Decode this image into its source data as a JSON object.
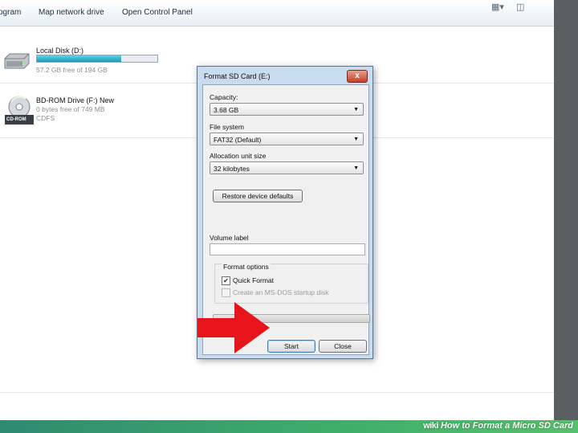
{
  "toolbar": {
    "items": [
      "ogram",
      "Map network drive",
      "Open Control Panel"
    ]
  },
  "drives": [
    {
      "name": "Local Disk (D:)",
      "free": "57.2 GB free of 194 GB",
      "used_fraction": 0.7,
      "icon": "hard-disk-icon"
    },
    {
      "name": "BD-ROM Drive (F:) New",
      "free": "0 bytes free of 749 MB",
      "fs": "CDFS",
      "icon_label": "CD-ROM",
      "icon": "optical-disc-icon"
    }
  ],
  "dialog": {
    "title": "Format SD Card (E:)",
    "close_glyph": "x",
    "capacity_label": "Capacity:",
    "capacity_value": "3.68 GB",
    "filesystem_label": "File system",
    "filesystem_value": "FAT32 (Default)",
    "allocation_label": "Allocation unit size",
    "allocation_value": "32 kilobytes",
    "restore_button": "Restore device defaults",
    "volume_label": "Volume label",
    "volume_value": "",
    "format_options_title": "Format options",
    "quick_format_label": "Quick Format",
    "quick_format_checked": true,
    "msdos_label": "Create an MS-DOS startup disk",
    "msdos_checked": false,
    "progress_fraction": 0,
    "start_button": "Start",
    "close_button": "Close"
  },
  "colors": {
    "arrow": "#e8141b",
    "accent": "#3399ff"
  },
  "banner": {
    "brand": "wiki",
    "text": "How to Format a Micro SD Card"
  }
}
